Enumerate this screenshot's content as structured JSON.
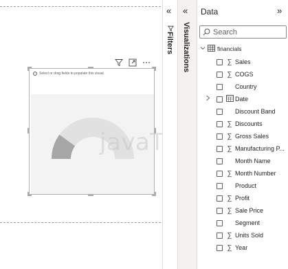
{
  "visual": {
    "hint": "Select or drag fields to populate this visual",
    "watermark": "javaTpoint",
    "gauge_fill_fraction": 0.2
  },
  "panes": {
    "filters_label": "Filters",
    "visualizations_label": "Visualizations"
  },
  "data_pane": {
    "title": "Data",
    "search_placeholder": "Search",
    "table_name": "financials",
    "fields": [
      {
        "name": "Sales",
        "icon": "sigma-icon"
      },
      {
        "name": "COGS",
        "icon": "sigma-icon"
      },
      {
        "name": "Country",
        "icon": "none"
      },
      {
        "name": "Date",
        "icon": "calendar-icon",
        "expandable": true
      },
      {
        "name": "Discount Band",
        "icon": "none"
      },
      {
        "name": "Discounts",
        "icon": "sigma-icon"
      },
      {
        "name": "Gross Sales",
        "icon": "sigma-icon"
      },
      {
        "name": "Manufacturing P...",
        "icon": "sigma-icon"
      },
      {
        "name": "Month Name",
        "icon": "none"
      },
      {
        "name": "Month Number",
        "icon": "sigma-icon"
      },
      {
        "name": "Product",
        "icon": "none"
      },
      {
        "name": "Profit",
        "icon": "sigma-icon"
      },
      {
        "name": "Sale Price",
        "icon": "sigma-icon"
      },
      {
        "name": "Segment",
        "icon": "none"
      },
      {
        "name": "Units Sold",
        "icon": "sigma-icon"
      },
      {
        "name": "Year",
        "icon": "sigma-icon"
      }
    ]
  },
  "colors": {
    "gauge_track": "#e1e1e1",
    "gauge_fill": "#a6a6a6",
    "pane_bg": "#f3f2f1"
  }
}
